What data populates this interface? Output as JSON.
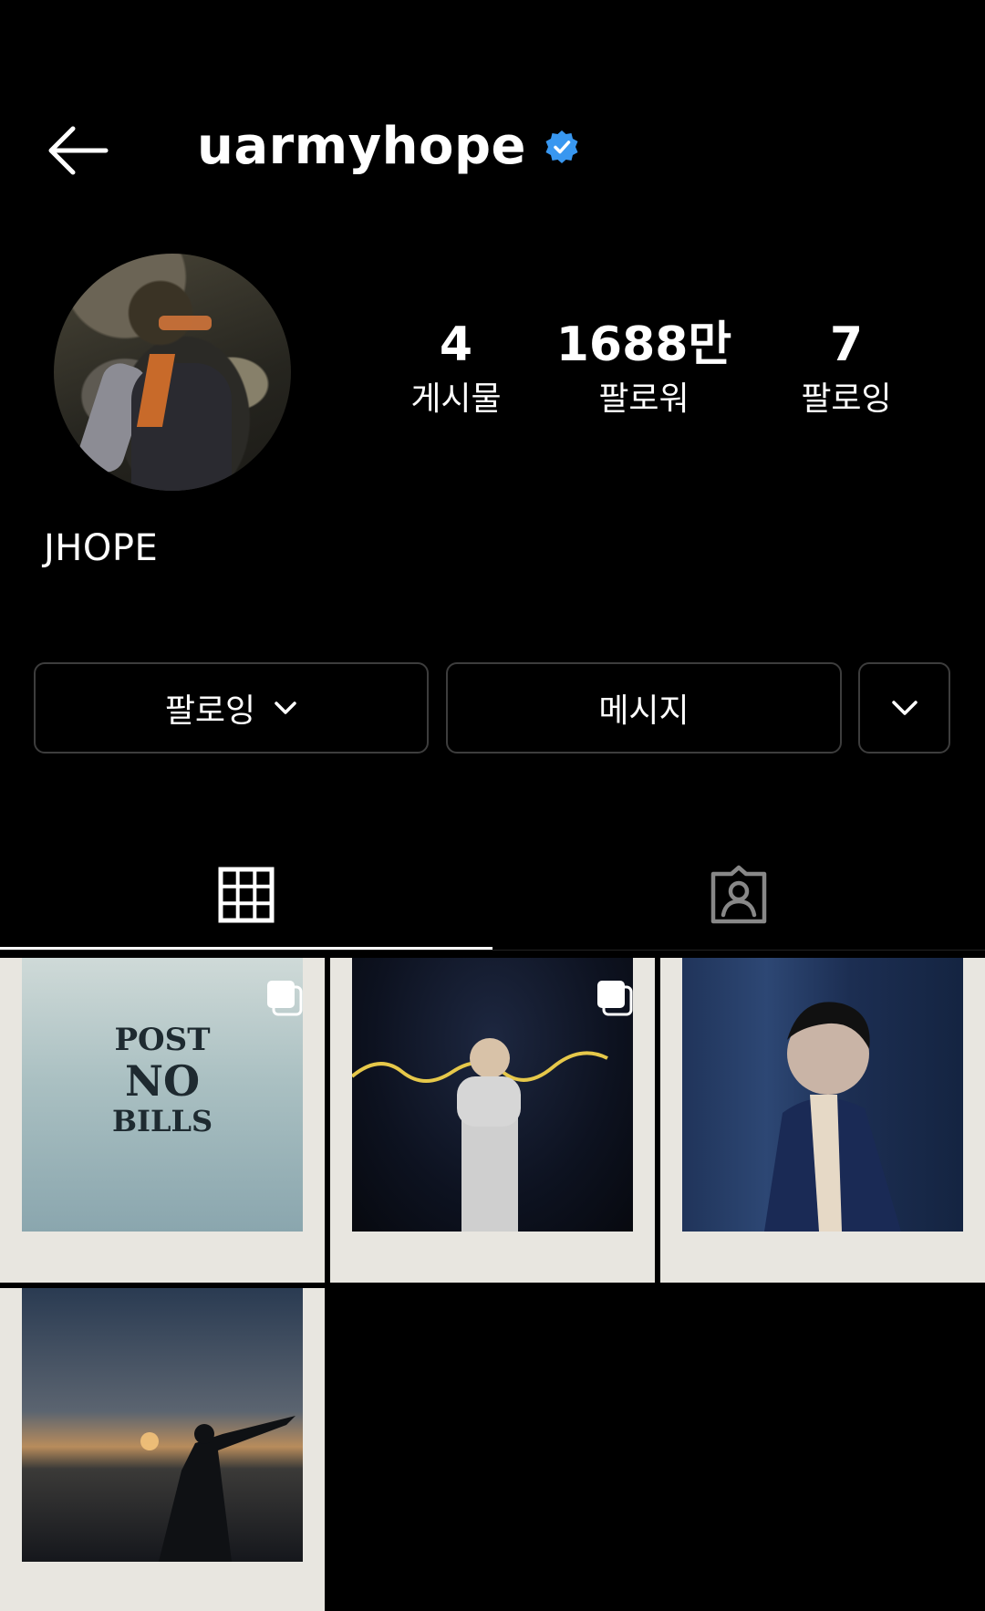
{
  "header": {
    "username": "uarmyhope",
    "verified": true
  },
  "profile": {
    "display_name": "JHOPE",
    "stats": [
      {
        "count": "4",
        "label": "게시물"
      },
      {
        "count": "1688만",
        "label": "팔로워"
      },
      {
        "count": "7",
        "label": "팔로잉"
      }
    ]
  },
  "actions": {
    "following_label": "팔로잉",
    "message_label": "메시지"
  },
  "tabs": {
    "active": "grid"
  },
  "posts": [
    {
      "multi": true,
      "stencil": [
        "POST",
        "NO",
        "BILLS"
      ]
    },
    {
      "multi": true
    },
    {
      "multi": false
    },
    {
      "multi": false
    }
  ],
  "colors": {
    "background": "#000000",
    "verified_badge": "#3897f0",
    "button_border": "#3d3d3d"
  }
}
